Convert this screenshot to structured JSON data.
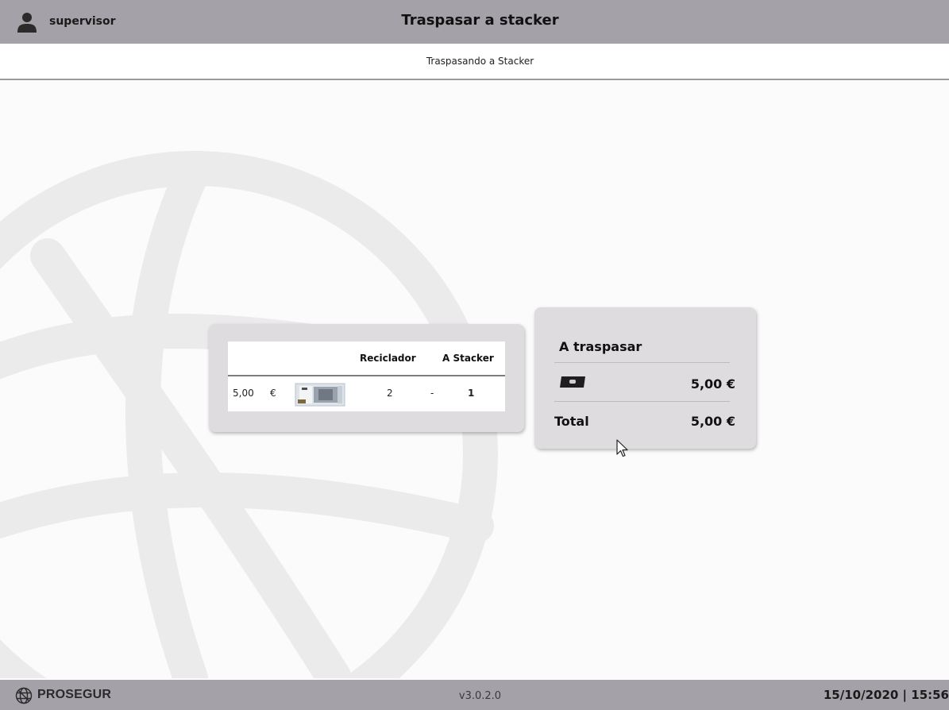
{
  "header": {
    "user_icon": "user-icon",
    "username": "supervisor",
    "title": "Traspasar a stacker",
    "subtitle": "Traspasando a Stacker"
  },
  "background": {
    "watermark_icon": "globe-icon"
  },
  "transfer_table": {
    "columns": [
      "",
      "Reciclador",
      "A Stacker"
    ],
    "rows": [
      {
        "denomination": "5,00",
        "currency": "€",
        "icon": "banknote-icon",
        "reciclador": "2",
        "separator": "-",
        "a_stacker": "1"
      }
    ]
  },
  "summary": {
    "title": "A traspasar",
    "lines": [
      {
        "icon": "banknote-icon",
        "amount": "5,00 €"
      }
    ],
    "total_label": "Total",
    "total_amount": "5,00 €"
  },
  "footer": {
    "logo_icon": "prosegur-globe-icon",
    "brand": "PROSEGUR",
    "version": "v3.0.2.0",
    "datetime": "15/10/2020 | 15:56"
  },
  "colors": {
    "bar": "#a5a1a9",
    "panel": "#dedcde",
    "background": "#fbfbfb"
  }
}
